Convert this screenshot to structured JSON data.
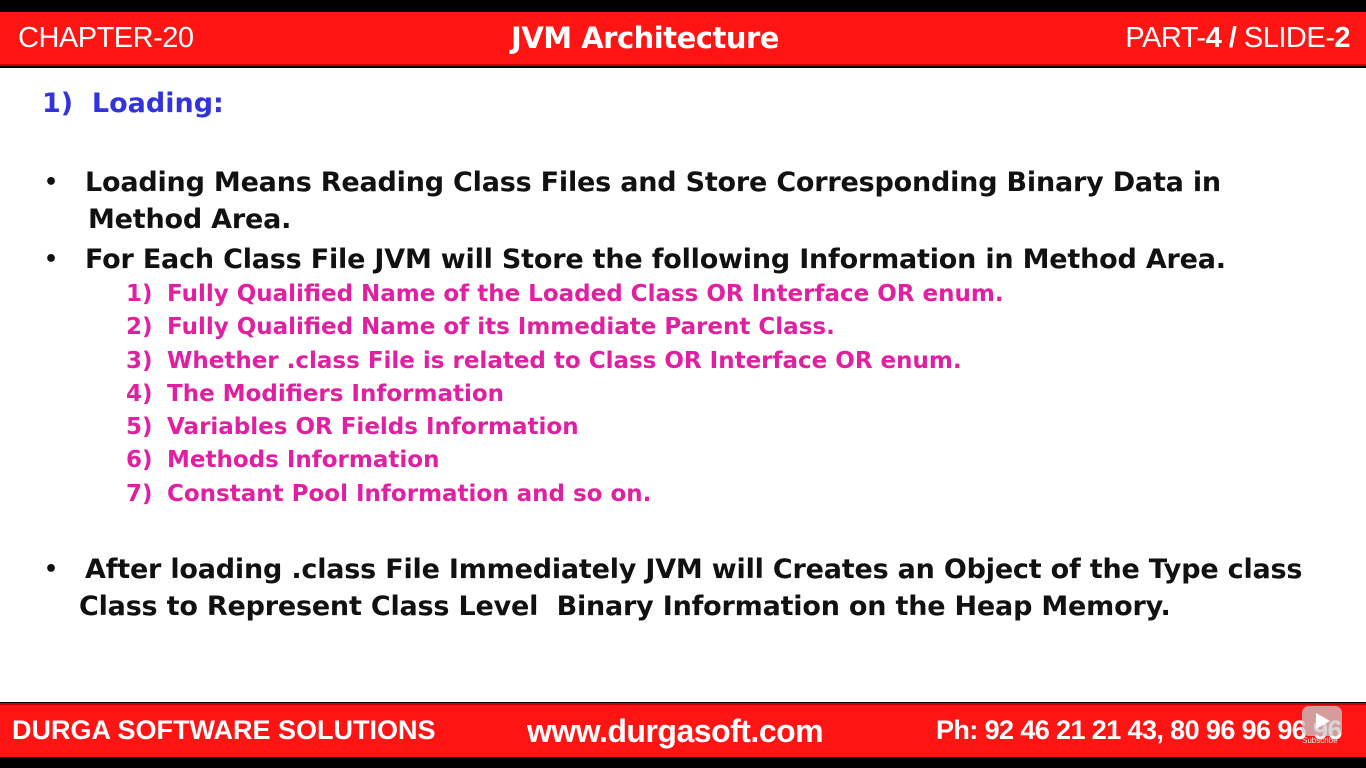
{
  "header": {
    "chapter": "CHAPTER-20",
    "title": "JVM Architecture",
    "part_prefix": "PART-",
    "part_number": "4",
    "slide_separator": " / ",
    "slide_prefix": "SLIDE-",
    "slide_number": "2"
  },
  "slide": {
    "heading": "1)  Loading:",
    "bullet_char": "•",
    "bullets": [
      {
        "line1": "Loading Means Reading Class Files and Store Corresponding Binary Data in",
        "line2": "Method Area."
      },
      {
        "line1": "For Each Class File JVM will Store the following Information in Method Area."
      },
      {
        "line1": "After loading .class File Immediately JVM will Creates an Object of the Type class",
        "line2": "Class to Represent Class Level  Binary Information on the Heap Memory."
      }
    ],
    "sub_items": [
      {
        "num": "1)",
        "text": "Fully Qualified Name of the Loaded Class OR Interface OR enum."
      },
      {
        "num": "2)",
        "text": "Fully Qualified Name of its Immediate Parent Class."
      },
      {
        "num": "3)",
        "text": "Whether .class File is related to Class OR Interface OR enum."
      },
      {
        "num": "4)",
        "text": "The Modifiers Information"
      },
      {
        "num": "5)",
        "text": "Variables OR Fields Information"
      },
      {
        "num": "6)",
        "text": "Methods Information"
      },
      {
        "num": "7)",
        "text": "Constant Pool Information and so on."
      }
    ]
  },
  "footer": {
    "company": "DURGA SOFTWARE SOLUTIONS",
    "website": "www.durgasoft.com",
    "phone": "Ph: 92 46 21 21 43, 80 96 96 96 96"
  },
  "overlay": {
    "icon": "youtube-subscribe-icon",
    "label": "Subscribe"
  },
  "colors": {
    "banner": "#ff1414",
    "heading": "#3333dd",
    "sub_items": "#e020a0",
    "body_text": "#111111"
  }
}
